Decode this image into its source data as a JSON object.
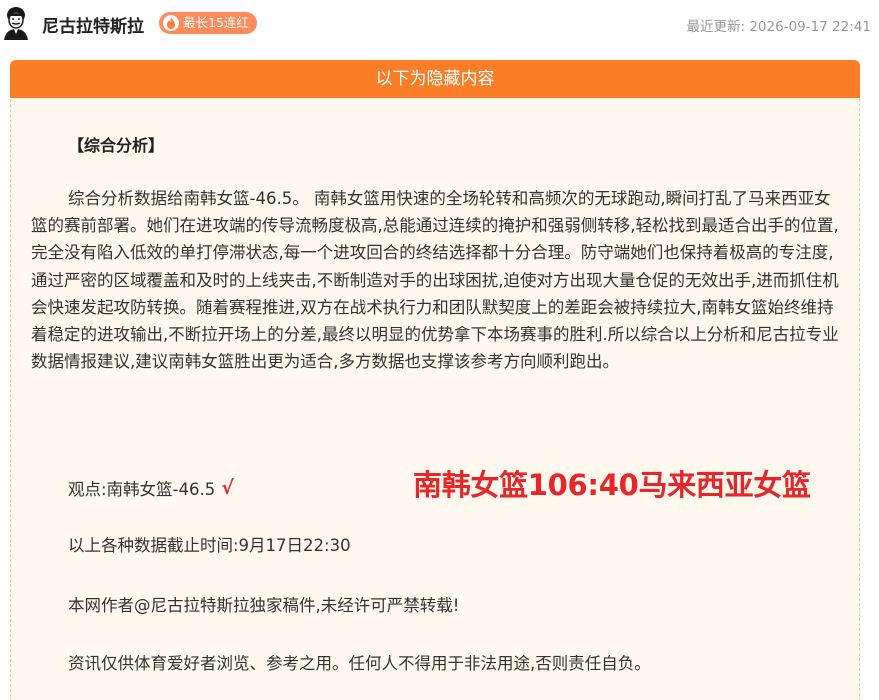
{
  "header": {
    "author_name": "尼古拉特斯拉",
    "streak_badge": "最长15连红",
    "update_label": "最近更新:",
    "update_time": "2026-09-17 22:41"
  },
  "content": {
    "hidden_banner": "以下为隐藏内容",
    "section_title": "【综合分析】",
    "analysis": "综合分析数据给南韩女篮-46.5。 南韩女篮用快速的全场轮转和高频次的无球跑动,瞬间打乱了马来西亚女篮的赛前部署。她们在进攻端的传导流畅度极高,总能通过连续的掩护和强弱侧转移,轻松找到最适合出手的位置,完全没有陷入低效的单打停滞状态,每一个进攻回合的终结选择都十分合理。防守端她们也保持着极高的专注度,通过严密的区域覆盖和及时的上线夹击,不断制造对手的出球困扰,迫使对方出现大量仓促的无效出手,进而抓住机会快速发起攻防转换。随着赛程推进,双方在战术执行力和团队默契度上的差距会被持续拉大,南韩女篮始终维持着稳定的进攻输出,不断拉开场上的分差,最终以明显的优势拿下本场赛事的胜利.所以综合以上分析和尼古拉专业数据情报建议,建议南韩女篮胜出更为适合,多方数据也支撑该参考方向顺利跑出。",
    "viewpoint": "观点:南韩女篮-46.5",
    "check_mark": "√",
    "final_score": "南韩女篮106:40马来西亚女篮",
    "cutoff": "以上各种数据截止时间:9月17日22:30",
    "copyright": "本网作者@尼古拉特斯拉独家稿件,未经许可严禁转载!",
    "disclaimer": "资讯仅供体育爱好者浏览、参考之用。任何人不得用于非法用途,否则责任自负。"
  },
  "colors": {
    "accent_orange": "#fb7d28",
    "badge_orange": "#ff8a5c",
    "result_red": "#e8262a",
    "panel_bg": "#fff8ee"
  }
}
